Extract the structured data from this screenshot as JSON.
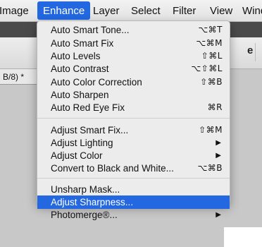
{
  "menubar": {
    "items": [
      {
        "label": "Image"
      },
      {
        "label": "Enhance"
      },
      {
        "label": "Layer"
      },
      {
        "label": "Select"
      },
      {
        "label": "Filter"
      },
      {
        "label": "View"
      },
      {
        "label": "Wind"
      }
    ]
  },
  "background": {
    "options_label": "e",
    "document_tab": "B/8) *"
  },
  "menu": {
    "groups": [
      {
        "items": [
          {
            "label": "Auto Smart Tone...",
            "shortcut": "⌥⌘T"
          },
          {
            "label": "Auto Smart Fix",
            "shortcut": "⌥⌘M"
          },
          {
            "label": "Auto Levels",
            "shortcut": "⇧⌘L"
          },
          {
            "label": "Auto Contrast",
            "shortcut": "⌥⇧⌘L"
          },
          {
            "label": "Auto Color Correction",
            "shortcut": "⇧⌘B"
          },
          {
            "label": "Auto Sharpen",
            "shortcut": ""
          },
          {
            "label": "Auto Red Eye Fix",
            "shortcut": "⌘R"
          }
        ]
      },
      {
        "items": [
          {
            "label": "Adjust Smart Fix...",
            "shortcut": "⇧⌘M"
          },
          {
            "label": "Adjust Lighting",
            "shortcut": "",
            "submenu_arrow": "▶"
          },
          {
            "label": "Adjust Color",
            "shortcut": "",
            "submenu_arrow": "▶"
          },
          {
            "label": "Convert to Black and White...",
            "shortcut": "⌥⌘B"
          }
        ]
      },
      {
        "items": [
          {
            "label": "Unsharp Mask...",
            "shortcut": ""
          },
          {
            "label": "Adjust Sharpness...",
            "shortcut": "",
            "highlighted": true
          },
          {
            "label": "Photomerge®...",
            "shortcut": "",
            "submenu_arrow": "▶"
          }
        ]
      }
    ]
  },
  "colors": {
    "highlight": "#2368e0",
    "menu_bg": "#ececec",
    "text": "#111111"
  }
}
